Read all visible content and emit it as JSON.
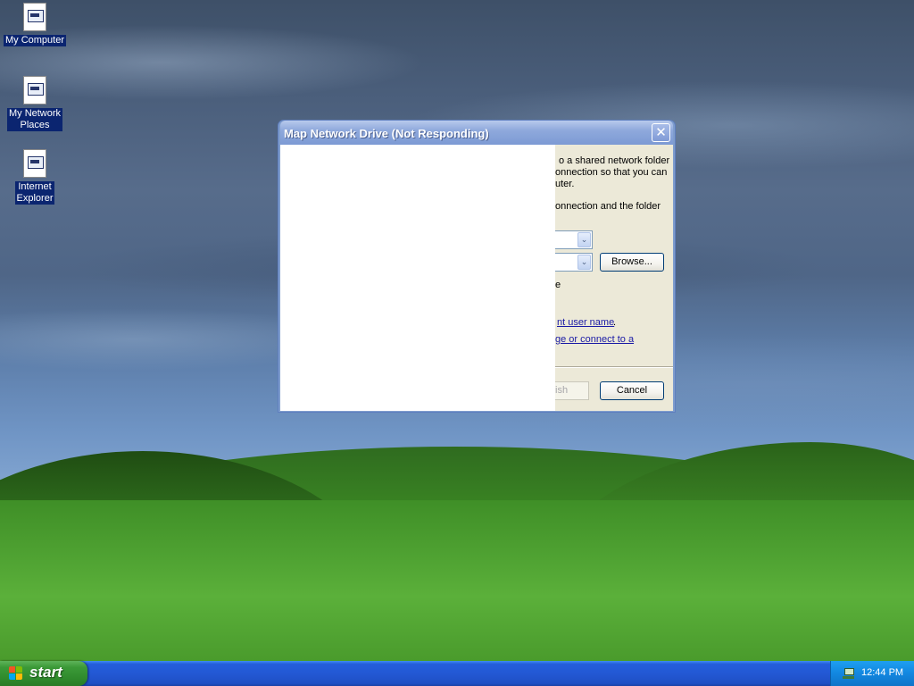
{
  "desktop": {
    "icons": [
      {
        "label": "My Computer",
        "icon": "document-window-icon"
      },
      {
        "label": "My Network\nPlaces",
        "icon": "document-window-icon"
      },
      {
        "label": "Internet\nExplorer",
        "icon": "document-window-icon"
      }
    ]
  },
  "dialog": {
    "title": "Map Network Drive (Not Responding)",
    "close_glyph": "✕",
    "text_lines": [
      "o a shared network folder",
      "onnection so that you can",
      "uter.",
      "onnection and the folder",
      "e"
    ],
    "links": [
      "nt user name",
      "ge or connect to a"
    ],
    "link1_suffix": ".",
    "combo_arrow_glyph": "⌄",
    "browse_label": "Browse...",
    "finish_partial_label": "ish",
    "cancel_label": "Cancel"
  },
  "taskbar": {
    "start_label": "start",
    "clock": "12:44 PM",
    "tray_icon": "safely-remove-hardware-icon"
  },
  "colors": {
    "title_bar": "#7c9ad4",
    "dialog_face": "#ece9d8",
    "taskbar": "#245edb",
    "start_button": "#3c9a38",
    "tray": "#1287e0",
    "link": "#1a1aa6"
  }
}
